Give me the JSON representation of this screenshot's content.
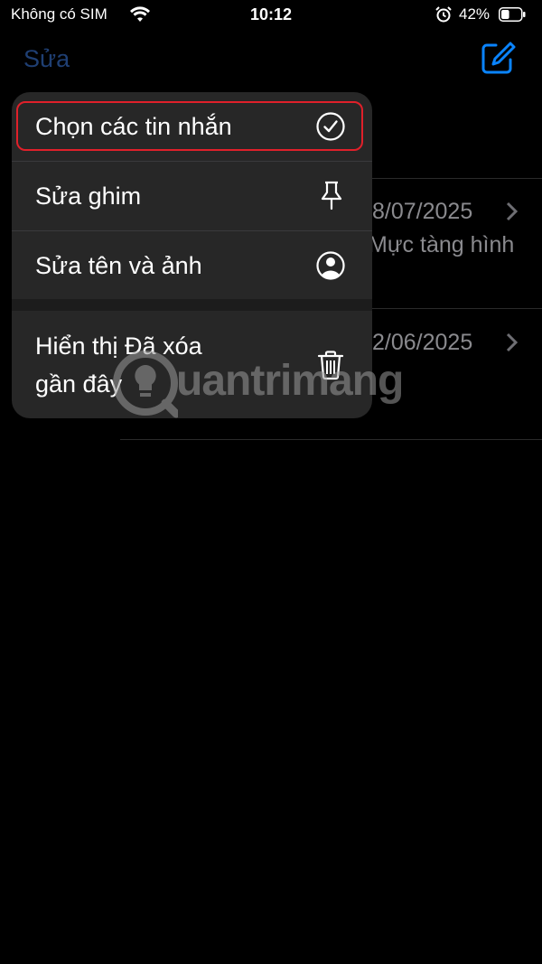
{
  "status_bar": {
    "carrier": "Không có SIM",
    "time": "10:12",
    "battery_percent": "42%",
    "battery_level": 0.42
  },
  "nav": {
    "edit_label": "Sửa",
    "compose_icon": "compose-icon"
  },
  "conversations": [
    {
      "date": "8/07/2025",
      "preview": "Mực tàng hình"
    },
    {
      "date": "2/06/2025",
      "preview": ""
    }
  ],
  "menu": {
    "items": [
      {
        "label": "Chọn các tin nhắn",
        "icon": "checkmark-circle-icon"
      },
      {
        "label": "Sửa ghim",
        "icon": "pin-icon"
      },
      {
        "label": "Sửa tên và ảnh",
        "icon": "person-circle-icon"
      },
      {
        "label_line1": "Hiển thị Đã xóa",
        "label_line2": "gần đây",
        "icon": "trash-icon"
      }
    ]
  },
  "watermark": {
    "text": "uantrimang"
  },
  "colors": {
    "accent": "#0a84ff",
    "highlight_border": "#e0202a",
    "menu_bg": "#272727"
  }
}
